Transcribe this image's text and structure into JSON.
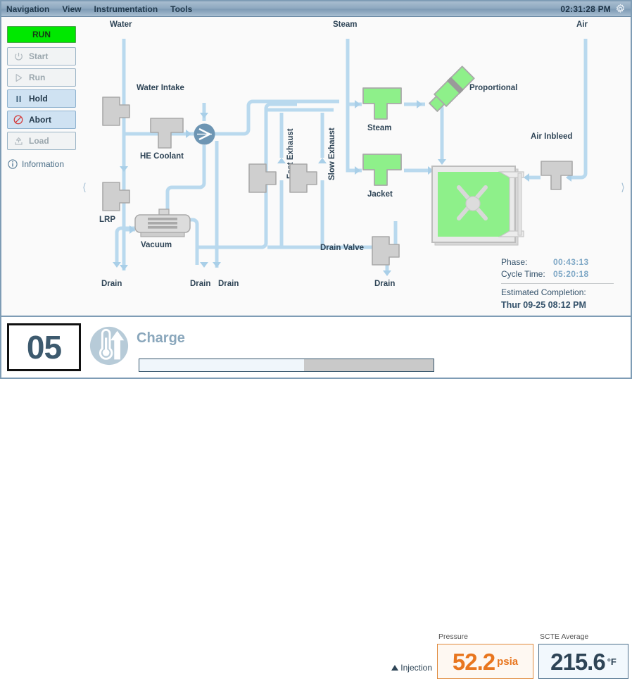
{
  "menu": {
    "items": [
      "Navigation",
      "View",
      "Instrumentation",
      "Tools"
    ],
    "clock": "02:31:28 PM",
    "gear_icon": "gear-icon"
  },
  "rail": {
    "state_banner": "RUN",
    "buttons": [
      {
        "label": "Start",
        "icon": "power-icon",
        "state": "disabled"
      },
      {
        "label": "Run",
        "icon": "play-icon",
        "state": "disabled"
      },
      {
        "label": "Hold",
        "icon": "pause-icon",
        "state": "enabled"
      },
      {
        "label": "Abort",
        "icon": "no-entry-icon",
        "state": "enabled"
      },
      {
        "label": "Load",
        "icon": "upload-icon",
        "state": "disabled"
      }
    ],
    "information_label": "Information",
    "information_icon": "info-icon",
    "prev_chevron": "chevron-left-icon",
    "next_chevron": "chevron-right-icon"
  },
  "schematic": {
    "sources": {
      "water": "Water",
      "steam": "Steam",
      "air": "Air"
    },
    "components": [
      {
        "name": "Water Intake",
        "label": "Water Intake",
        "state": "closed"
      },
      {
        "name": "HE Coolant",
        "label": "HE Coolant",
        "state": "closed"
      },
      {
        "name": "LRP",
        "label": "LRP",
        "state": "closed"
      },
      {
        "name": "Vacuum",
        "label": "Vacuum",
        "state": "off"
      },
      {
        "name": "Fast Exhaust",
        "label": "Fast Exhaust",
        "state": "closed"
      },
      {
        "name": "Slow Exhaust",
        "label": "Slow Exhaust",
        "state": "closed"
      },
      {
        "name": "Steam",
        "label": "Steam",
        "state": "open"
      },
      {
        "name": "Jacket",
        "label": "Jacket",
        "state": "open"
      },
      {
        "name": "Proportional",
        "label": "Proportional",
        "state": "open"
      },
      {
        "name": "Air Inbleed",
        "label": "Air Inbleed",
        "state": "closed"
      },
      {
        "name": "Drain Valve",
        "label": "Drain Valve",
        "state": "closed"
      }
    ],
    "drains": [
      "Drain",
      "Drain",
      "Drain",
      "Drain"
    ],
    "colors": {
      "open_valve": "#8ef08a",
      "closed_valve": "#cfcfcf",
      "pipe": "#b9d9ee",
      "chamber_fill": "#8ef08a"
    }
  },
  "readout": {
    "phase_key": "Phase:",
    "phase_value": "00:43:13",
    "cycle_key": "Cycle Time:",
    "cycle_value": "05:20:18",
    "estimated_label": "Estimated Completion:",
    "estimated_value": "Thur 09-25 08:12 PM"
  },
  "status": {
    "phase_number": "05",
    "phase_icon": "thermometer-arrow-icon",
    "phase_name": "Charge",
    "progress_percent": 56,
    "injection_label": "Injection",
    "injection_icon": "triangle-up-icon",
    "gauges": [
      {
        "id": "pressure",
        "title": "Pressure",
        "value": "52.2",
        "unit": "psia",
        "color": "#e8761f"
      },
      {
        "id": "scte",
        "title": "SCTE Average",
        "value": "215.6",
        "unit": "°F",
        "color": "#2e4456"
      }
    ]
  }
}
